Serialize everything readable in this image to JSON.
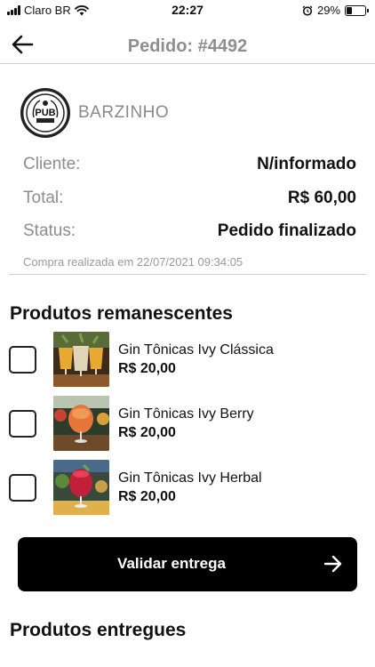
{
  "status_bar": {
    "carrier": "Claro BR",
    "time": "22:27",
    "battery": "29%",
    "battery_level": 0.29
  },
  "header": {
    "title": "Pedido: #4492",
    "back_icon": "arrow-left-icon"
  },
  "store": {
    "name": "BARZINHO",
    "logo_text": "PUB"
  },
  "order": {
    "client_label": "Cliente:",
    "client_value": "N/informado",
    "total_label": "Total:",
    "total_value": "R$ 60,00",
    "status_label": "Status:",
    "status_value": "Pedido finalizado",
    "purchase_date": "Compra realizada em 22/07/2021 09:34:05"
  },
  "remaining_section": {
    "title": "Produtos remanescentes",
    "products": [
      {
        "name": "Gin Tônicas Ivy Clássica",
        "price": "R$ 20,00",
        "checked": false
      },
      {
        "name": "Gin Tônicas Ivy Berry",
        "price": "R$ 20,00",
        "checked": false
      },
      {
        "name": "Gin Tônicas Ivy Herbal",
        "price": "R$ 20,00",
        "checked": false
      }
    ]
  },
  "validate_button": {
    "label": "Validar entrega",
    "icon": "arrow-right-icon"
  },
  "delivered_section": {
    "title": "Produtos entregues"
  },
  "colors": {
    "primary_button": "#000000",
    "muted_text": "#8d8d8d",
    "divider": "#cfcfcf"
  }
}
